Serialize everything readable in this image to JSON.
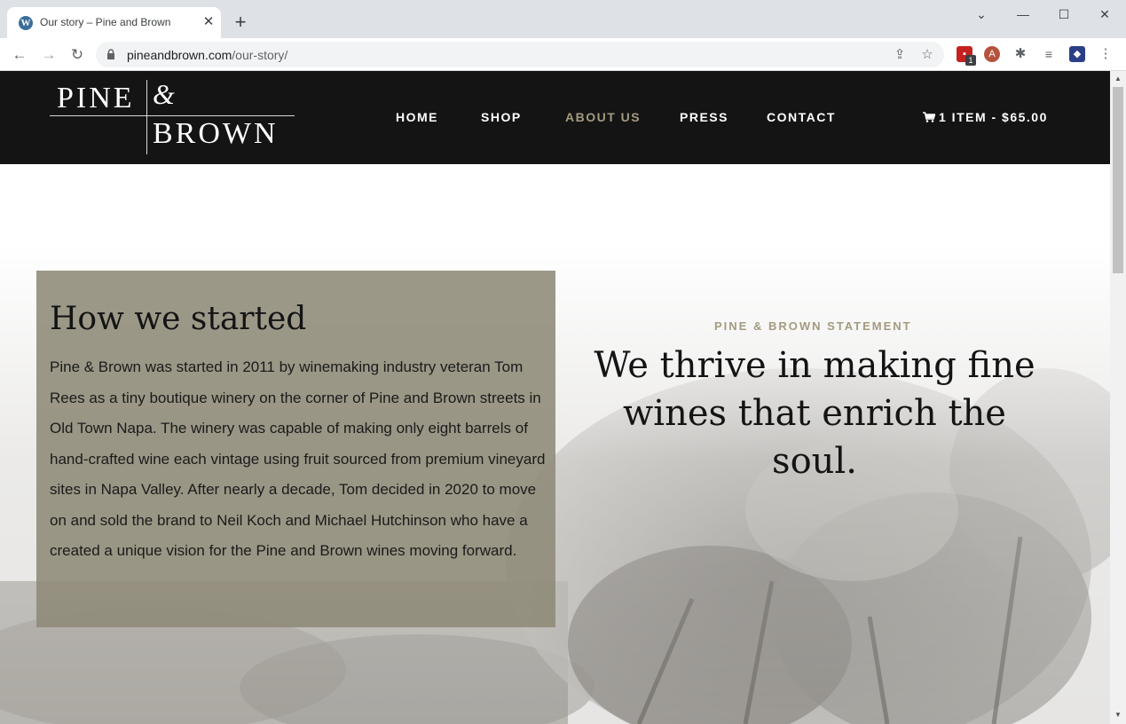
{
  "browser": {
    "tab_title": "Our story – Pine and Brown",
    "url_domain": "pineandbrown.com",
    "url_path": "/our-story/",
    "extension_badge": "1",
    "colors": {
      "tabbar": "#dee1e6",
      "omnibox": "#f1f3f4"
    }
  },
  "site": {
    "logo": {
      "pine": "PINE",
      "amp": "&",
      "brown": "BROWN"
    },
    "menu": [
      {
        "label": "HOME",
        "active": false
      },
      {
        "label": "SHOP",
        "active": false
      },
      {
        "label": "ABOUT US",
        "active": true
      },
      {
        "label": "PRESS",
        "active": false
      },
      {
        "label": "CONTACT",
        "active": false
      }
    ],
    "cart_label": "1 ITEM - $65.00",
    "colors": {
      "header_bg": "#141414",
      "accent": "#a39b80"
    }
  },
  "story": {
    "title": "How we started",
    "body": "Pine & Brown was started in 2011 by winemaking industry veteran Tom Rees as a tiny boutique winery on the corner of Pine and Brown streets in Old Town Napa.  The winery was capable of making only eight barrels of hand-crafted wine each vintage using fruit sourced from premium vineyard sites in Napa Valley. After nearly a decade, Tom decided  in 2020 to move on and sold the brand to Neil Koch and Michael Hutchinson who have a created a unique vision for the Pine and Brown wines moving forward."
  },
  "statement": {
    "label": "PINE & BROWN STATEMENT",
    "text": "We thrive in making fine wines that enrich the soul."
  }
}
